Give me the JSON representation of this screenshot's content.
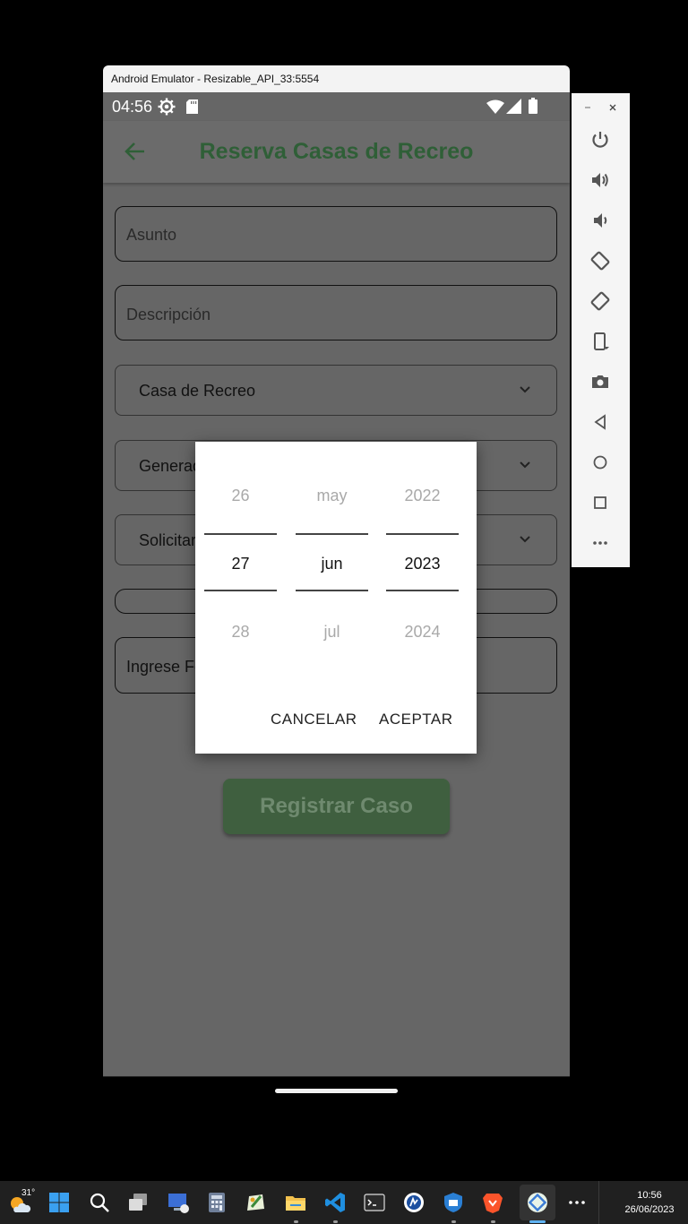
{
  "emulator": {
    "window_title": "Android Emulator - Resizable_API_33:5554"
  },
  "status_bar": {
    "time": "04:56"
  },
  "app_bar": {
    "title": "Reserva Casas de Recreo"
  },
  "form": {
    "asunto_placeholder": "Asunto",
    "descripcion_placeholder": "Descripción",
    "casa_dropdown": "Casa de Recreo",
    "generado_dropdown": "Generad",
    "solicitante_dropdown": "Solicitar",
    "fecha_placeholder": "Ingrese Fe",
    "submit_label": "Registrar Caso"
  },
  "date_picker": {
    "day": {
      "prev": "26",
      "selected": "27",
      "next": "28"
    },
    "month": {
      "prev": "may",
      "selected": "jun",
      "next": "jul"
    },
    "year": {
      "prev": "2022",
      "selected": "2023",
      "next": "2024"
    },
    "cancel_label": "CANCELAR",
    "accept_label": "ACEPTAR"
  },
  "taskbar": {
    "weather_temp": "31°",
    "clock_time": "10:56",
    "clock_date": "26/06/2023"
  },
  "colors": {
    "app_title": "#2f5f37",
    "register_button": "#3f5f3f",
    "scrim": "#666666"
  }
}
